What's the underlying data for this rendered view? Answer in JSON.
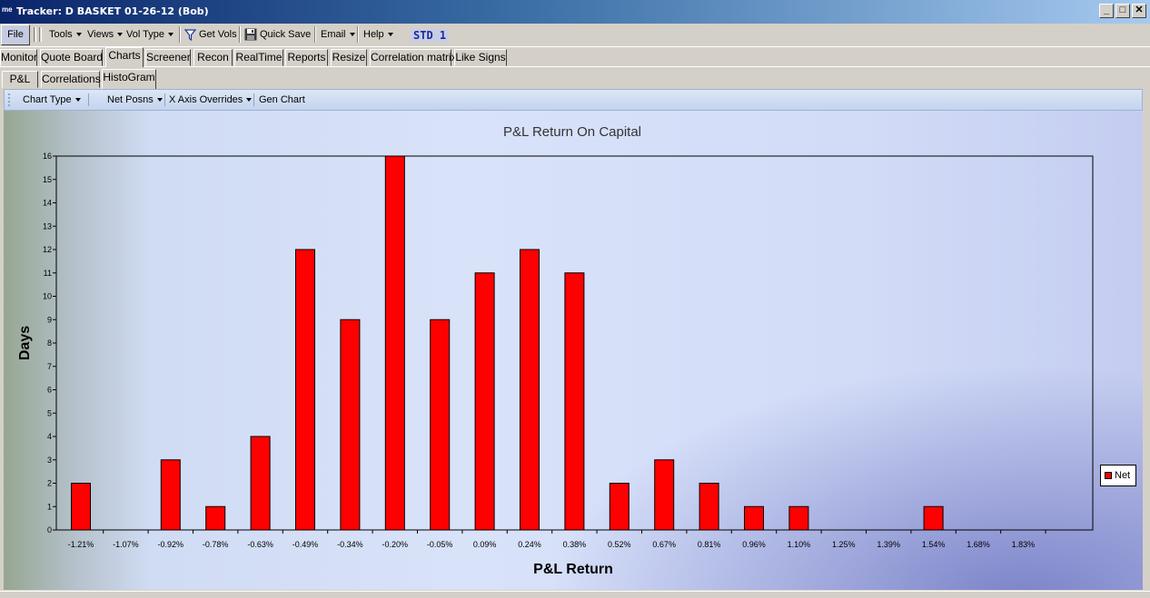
{
  "window": {
    "title": "Tracker: D BASKET 01-26-12   (Bob)",
    "app_icon_text": "me",
    "minimize": "_",
    "maximize": "□",
    "close": "✕"
  },
  "menubar": {
    "file": "File",
    "tools": "Tools",
    "views": "Views",
    "vol_type": "Vol Type",
    "get_vols": "Get Vols",
    "quick_save": "Quick Save",
    "email": "Email",
    "help": "Help",
    "std_badge": "STD 1"
  },
  "main_tabs": [
    "Monitor",
    "Quote Board",
    "Charts",
    "Screener",
    "Recon",
    "RealTime",
    "Reports",
    "Resize",
    "Correlation matrix",
    "Like Signs"
  ],
  "main_tab_active": "Charts",
  "sub_tabs": [
    "P&L",
    "Correlations",
    "HistoGram"
  ],
  "sub_tab_active": "HistoGram",
  "chart_toolbar": {
    "chart_type": "Chart Type",
    "net_posns": "Net Posns",
    "x_axis_overrides": "X Axis Overrides",
    "gen_chart": "Gen Chart"
  },
  "colors": {
    "bar": "#ff0000",
    "title_bar": "#0a246a",
    "std_badge": "#1a2a9a"
  },
  "chart_data": {
    "type": "bar",
    "title": "P&L Return On Capital",
    "xlabel": "P&L Return",
    "ylabel": "Days",
    "categories": [
      "-1.21%",
      "-1.07%",
      "-0.92%",
      "-0.78%",
      "-0.63%",
      "-0.49%",
      "-0.34%",
      "-0.20%",
      "-0.05%",
      "0.09%",
      "0.24%",
      "0.38%",
      "0.52%",
      "0.67%",
      "0.81%",
      "0.96%",
      "1.10%",
      "1.25%",
      "1.39%",
      "1.54%",
      "1.68%",
      "1.83%"
    ],
    "series": [
      {
        "name": "Net",
        "values": [
          2,
          0,
          3,
          1,
          4,
          12,
          9,
          16,
          9,
          11,
          12,
          11,
          2,
          3,
          2,
          1,
          1,
          0,
          0,
          1,
          0,
          0
        ]
      }
    ],
    "ylim": [
      0,
      16
    ],
    "yticks": [
      0,
      1,
      2,
      3,
      4,
      5,
      6,
      7,
      8,
      9,
      10,
      11,
      12,
      13,
      14,
      15,
      16
    ],
    "legend_position": "right",
    "grid": false
  }
}
